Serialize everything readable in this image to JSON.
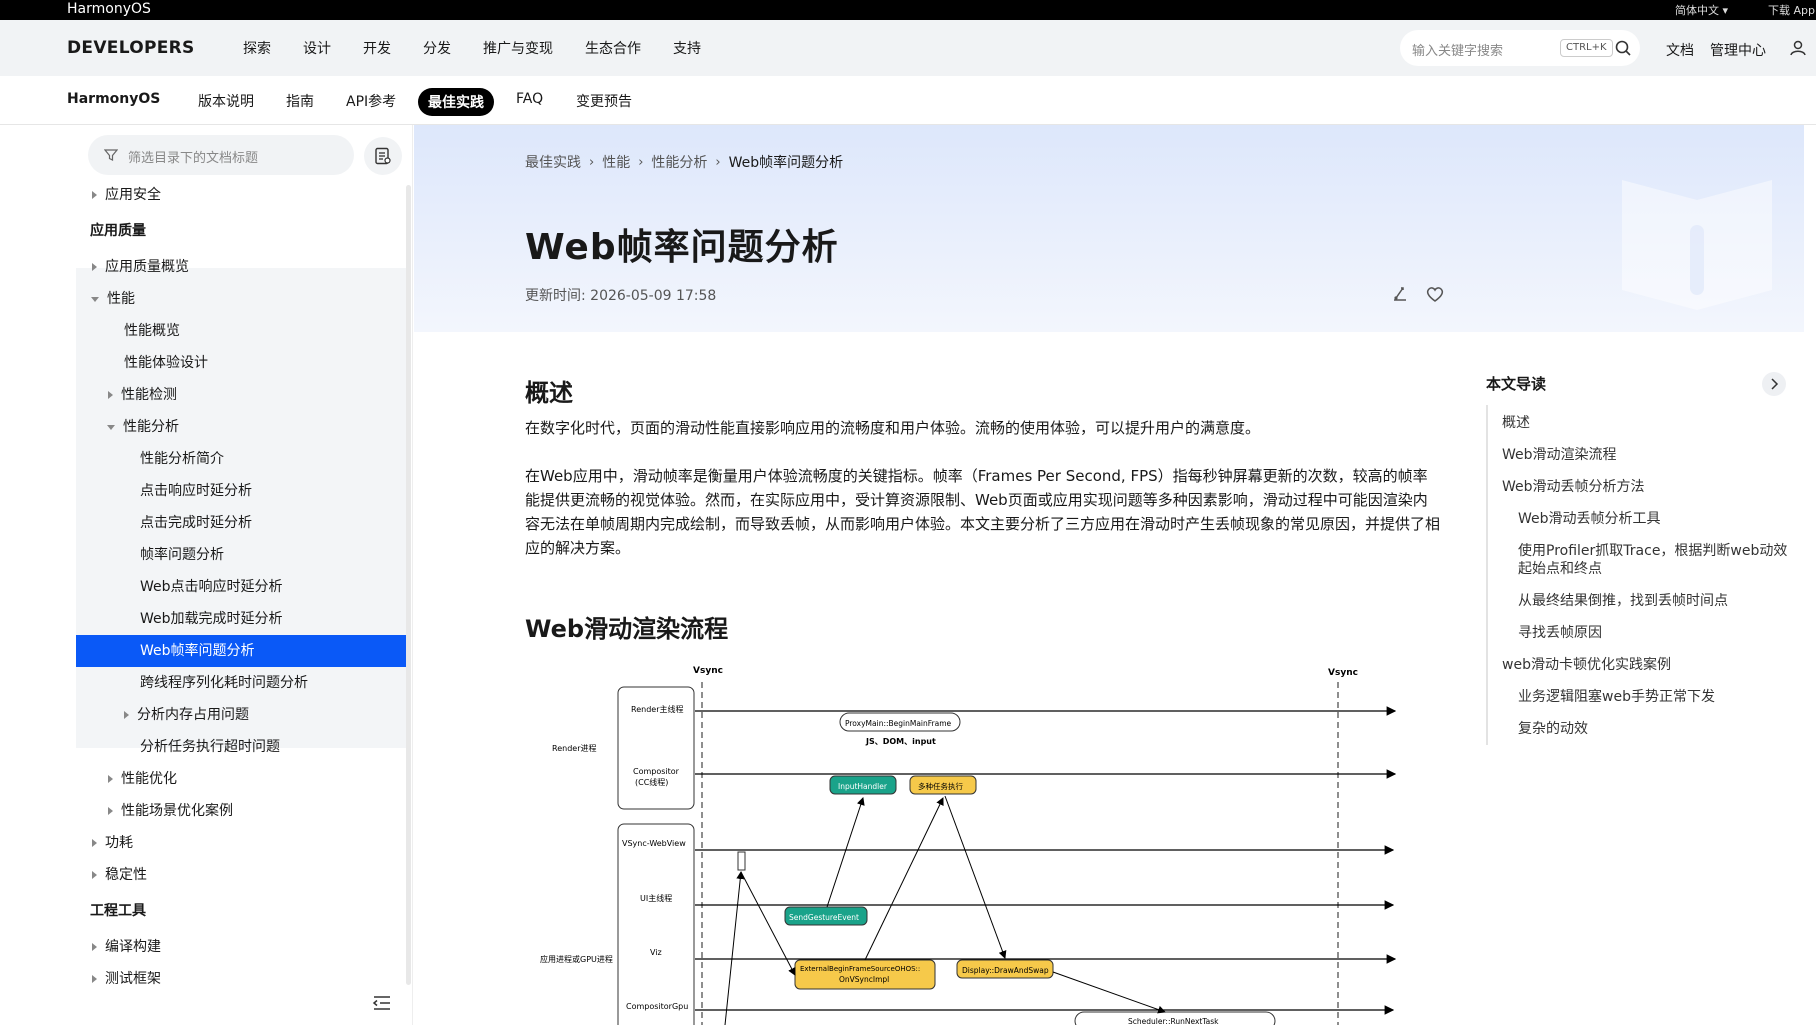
{
  "topbar": {
    "brand": "HarmonyOS",
    "language": "简体中文",
    "download": "下载 App"
  },
  "header": {
    "logo": "DEVELOPERS",
    "nav": [
      "探索",
      "设计",
      "开发",
      "分发",
      "推广与变现",
      "生态合作",
      "支持"
    ],
    "search_placeholder": "输入关键字搜索",
    "search_shortcut": "CTRL+K",
    "docs_link": "文档",
    "console_link": "管理中心"
  },
  "subnav": {
    "product": "HarmonyOS",
    "tabs": [
      "版本说明",
      "指南",
      "API参考",
      "最佳实践",
      "FAQ",
      "变更预告"
    ],
    "active_tab": "最佳实践"
  },
  "sidebar": {
    "filter_placeholder": "筛选目录下的文档标题",
    "items": [
      {
        "label": "应用安全",
        "level": 0,
        "arrow": "right"
      },
      {
        "label": "应用质量",
        "level": 0,
        "section": true
      },
      {
        "label": "应用质量概览",
        "level": 0,
        "arrow": "right"
      },
      {
        "label": "性能",
        "level": 0,
        "arrow": "down"
      },
      {
        "label": "性能概览",
        "level": 1
      },
      {
        "label": "性能体验设计",
        "level": 1
      },
      {
        "label": "性能检测",
        "level": 1,
        "arrow": "right"
      },
      {
        "label": "性能分析",
        "level": 1,
        "arrow": "down"
      },
      {
        "label": "性能分析简介",
        "level": 2
      },
      {
        "label": "点击响应时延分析",
        "level": 2
      },
      {
        "label": "点击完成时延分析",
        "level": 2
      },
      {
        "label": "帧率问题分析",
        "level": 2
      },
      {
        "label": "Web点击响应时延分析",
        "level": 2
      },
      {
        "label": "Web加载完成时延分析",
        "level": 2
      },
      {
        "label": "Web帧率问题分析",
        "level": 2,
        "selected": true
      },
      {
        "label": "跨线程序列化耗时问题分析",
        "level": 2
      },
      {
        "label": "分析内存占用问题",
        "level": 2,
        "arrow": "right"
      },
      {
        "label": "分析任务执行超时问题",
        "level": 2
      },
      {
        "label": "性能优化",
        "level": 1,
        "arrow": "right"
      },
      {
        "label": "性能场景优化案例",
        "level": 1,
        "arrow": "right"
      },
      {
        "label": "功耗",
        "level": 0,
        "arrow": "right"
      },
      {
        "label": "稳定性",
        "level": 0,
        "arrow": "right"
      },
      {
        "label": "工程工具",
        "level": 0,
        "section": true
      },
      {
        "label": "编译构建",
        "level": 0,
        "arrow": "right"
      },
      {
        "label": "测试框架",
        "level": 0,
        "arrow": "right"
      }
    ]
  },
  "breadcrumb": [
    "最佳实践",
    "性能",
    "性能分析",
    "Web帧率问题分析"
  ],
  "article": {
    "title": "Web帧率问题分析",
    "updated": "更新时间: 2026-05-09 17:58",
    "sections": [
      {
        "heading": "概述",
        "paragraphs": [
          "在数字化时代，页面的滑动性能直接影响应用的流畅度和用户体验。流畅的使用体验，可以提升用户的满意度。",
          "在Web应用中，滑动帧率是衡量用户体验流畅度的关键指标。帧率（Frames Per Second, FPS）指每秒钟屏幕更新的次数，较高的帧率能提供更流畅的视觉体验。然而，在实际应用中，受计算资源限制、Web页面或应用实现问题等多种因素影响，滑动过程中可能因渲染内容无法在单帧周期内完成绘制，而导致丢帧，从而影响用户体验。本文主要分析了三方应用在滑动时产生丢帧现象的常见原因，并提供了相应的解决方案。"
        ]
      },
      {
        "heading": "Web滑动渲染流程"
      }
    ]
  },
  "toc": {
    "title": "本文导读",
    "items": [
      {
        "label": "概述",
        "level": 0
      },
      {
        "label": "Web滑动渲染流程",
        "level": 0
      },
      {
        "label": "Web滑动丢帧分析方法",
        "level": 0
      },
      {
        "label": "Web滑动丢帧分析工具",
        "level": 1
      },
      {
        "label": "使用Profiler抓取Trace，根据判断web动效起始点和终点",
        "level": 1
      },
      {
        "label": "从最终结果倒推，找到丢帧时间点",
        "level": 1
      },
      {
        "label": "寻找丢帧原因",
        "level": 1
      },
      {
        "label": "web滑动卡顿优化实践案例",
        "level": 0
      },
      {
        "label": "业务逻辑阻塞web手势正常下发",
        "level": 1
      },
      {
        "label": "复杂的动效",
        "level": 1
      }
    ]
  },
  "diagram": {
    "vsync_label": "Vsync",
    "render_process": "Render进程",
    "app_process": "应用进程或GPU进程",
    "lanes": {
      "render_main": "Render主线程",
      "compositor": "Compositor",
      "compositor_sub": "(CC线程)",
      "vsync_webview": "VSync-WebView",
      "ui_main": "UI主线程",
      "viz": "Viz",
      "compositor_gpu": "CompositorGpu"
    },
    "boxes": {
      "begin_main_frame": "ProxyMain::BeginMainFrame",
      "js_dom_input": "JS、DOM、input",
      "input_handler": "InputHandler",
      "multi_task": "多种任务执行",
      "send_gesture": "SendGestureEvent",
      "external_begin_1": "ExternalBeginFrameSourceOHOS::",
      "external_begin_2": "OnVSyncImpl",
      "draw_and_swap": "Display::DrawAndSwap",
      "run_next_task": "Scheduler::RunNextTask"
    },
    "colors": {
      "teal": "#1aa38a",
      "yellow": "#f6c94a"
    }
  }
}
